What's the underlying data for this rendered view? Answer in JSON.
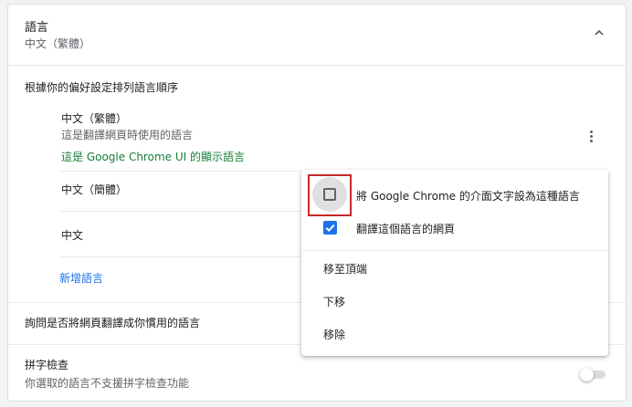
{
  "language_section": {
    "title": "語言",
    "subtitle": "中文（繁體）",
    "order_label": "根據你的偏好設定排列語言順序",
    "languages": [
      {
        "name": "中文（繁體）",
        "description": "這是翻譯網頁時使用的語言",
        "ui_note": "這是 Google Chrome UI 的顯示語言"
      },
      {
        "name": "中文（簡體）"
      },
      {
        "name": "中文"
      }
    ],
    "add_language": "新增語言",
    "offer_translate_label": "詢問是否將網頁翻譯成你慣用的語言"
  },
  "spellcheck": {
    "title": "拼字檢查",
    "description": "你選取的語言不支援拼字檢查功能",
    "enabled": false
  },
  "context_menu": {
    "display_in_chrome": {
      "label": "將 Google Chrome 的介面文字設為這種語言",
      "checked": false
    },
    "offer_translate": {
      "label": "翻譯這個語言的網頁",
      "checked": true
    },
    "move_to_top": "移至頂端",
    "move_down": "下移",
    "remove": "移除"
  },
  "colors": {
    "accent": "#1a73e8",
    "ui_note_green": "#188038",
    "highlight_red": "#c62828"
  }
}
